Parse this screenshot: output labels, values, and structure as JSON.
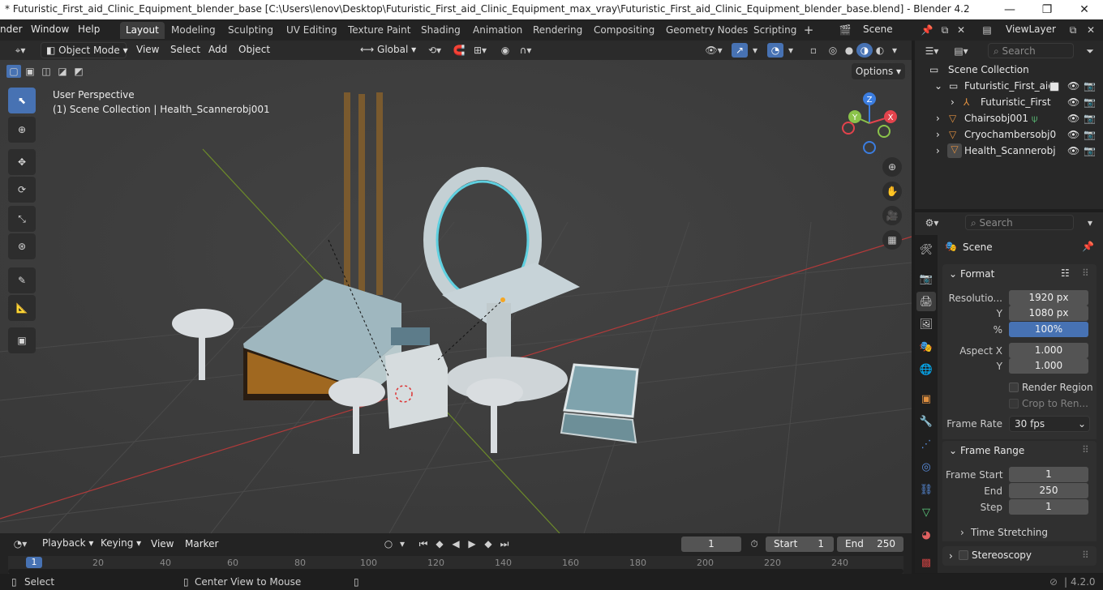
{
  "window": {
    "title": "* Futuristic_First_aid_Clinic_Equipment_blender_base [C:\\Users\\lenov\\Desktop\\Futuristic_First_aid_Clinic_Equipment_max_vray\\Futuristic_First_aid_Clinic_Equipment_blender_base.blend] - Blender 4.2",
    "minimize": "—",
    "maximize": "❐",
    "close": "✕"
  },
  "menu": [
    "nder",
    "Window",
    "Help"
  ],
  "workspaces": [
    "Layout",
    "Modeling",
    "Sculpting",
    "UV Editing",
    "Texture Paint",
    "Shading",
    "Animation",
    "Rendering",
    "Compositing",
    "Geometry Nodes",
    "Scripting"
  ],
  "scene_selector": {
    "value": "Scene"
  },
  "viewlayer_selector": {
    "value": "ViewLayer"
  },
  "viewport_header": {
    "mode": "Object Mode",
    "menus": [
      "View",
      "Select",
      "Add",
      "Object"
    ],
    "orientation": "Global",
    "options_label": "Options"
  },
  "viewport": {
    "perspective_label": "User Perspective",
    "collection_label": "(1) Scene Collection | Health_Scannerobj001",
    "gizmo_axes": {
      "x": "X",
      "y": "Y",
      "z": "Z"
    },
    "colors": {
      "x": "#e3434c",
      "y": "#8bc34a",
      "z": "#3b7de0",
      "grid_bg": "#3d3d3d"
    }
  },
  "outliner": {
    "search_placeholder": "Search",
    "root": "Scene Collection",
    "items": [
      {
        "label": "Futuristic_First_aid",
        "type": "collection"
      },
      {
        "label": "Futuristic_First",
        "type": "armature"
      },
      {
        "label": "Chairsobj001",
        "type": "mesh"
      },
      {
        "label": "Cryochambersobj0",
        "type": "mesh"
      },
      {
        "label": "Health_Scannerobj",
        "type": "mesh"
      }
    ]
  },
  "properties": {
    "search_placeholder": "Search",
    "context": "Scene",
    "format": {
      "header": "Format",
      "resolution_label": "Resolutio...",
      "res_x": "1920 px",
      "y_label": "Y",
      "res_y": "1080 px",
      "pct_label": "%",
      "res_pct": "100%",
      "aspect_x_label": "Aspect X",
      "aspect_x": "1.000",
      "aspect_y_label": "Y",
      "aspect_y": "1.000",
      "render_region": "Render Region",
      "crop": "Crop to Ren...",
      "frame_rate_label": "Frame Rate",
      "frame_rate": "30 fps"
    },
    "frame_range": {
      "header": "Frame Range",
      "start_label": "Frame Start",
      "start": "1",
      "end_label": "End",
      "end": "250",
      "step_label": "Step",
      "step": "1"
    },
    "time_stretching": "Time Stretching",
    "stereoscopy": "Stereoscopy"
  },
  "timeline": {
    "menus": [
      "Playback",
      "Keying",
      "View",
      "Marker"
    ],
    "current_frame": "1",
    "start_label": "Start",
    "start": "1",
    "end_label": "End",
    "end": "250",
    "ruler": [
      "1",
      "20",
      "40",
      "60",
      "80",
      "100",
      "120",
      "140",
      "160",
      "180",
      "200",
      "220",
      "240"
    ]
  },
  "statusbar": {
    "select": "Select",
    "center": "Center View to Mouse",
    "version": "4.2.0"
  }
}
